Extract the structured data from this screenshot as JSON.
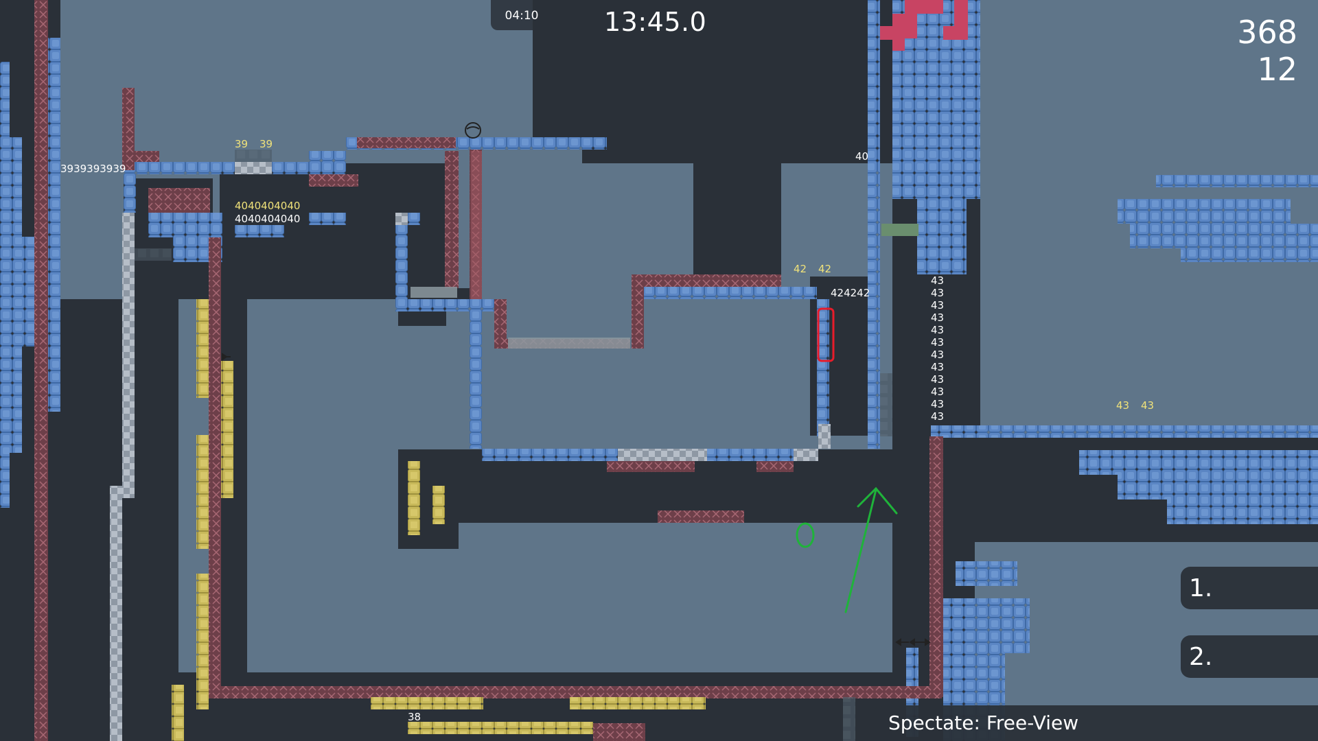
{
  "hud": {
    "timer_small": "04:10",
    "timer_main": "13:45.0",
    "score_primary": "368",
    "score_secondary": "12",
    "rank_1": "1.",
    "rank_2": "2.",
    "spectate_label": "Spectate: Free-View"
  },
  "map_labels": {
    "t39_run": "3939393939",
    "t39_a": "39",
    "t39_b": "39",
    "t40_row1": "4040404040",
    "t40_row2": "4040404040",
    "t40_right": "40",
    "t42_a": "42",
    "t42_b": "42",
    "t42_run": "424242",
    "t43": "43",
    "t43_a": "43",
    "t43_b": "43",
    "t38": "38"
  },
  "colors": {
    "background": "#5f7589",
    "solid": "#2a3038",
    "unhookable": "#5b86c4",
    "freeze": "#7a4550",
    "yellow": "#c8b95a",
    "annotation_red": "#e81c2a",
    "annotation_green": "#1fb33a",
    "spike_pink": "#c84463"
  }
}
